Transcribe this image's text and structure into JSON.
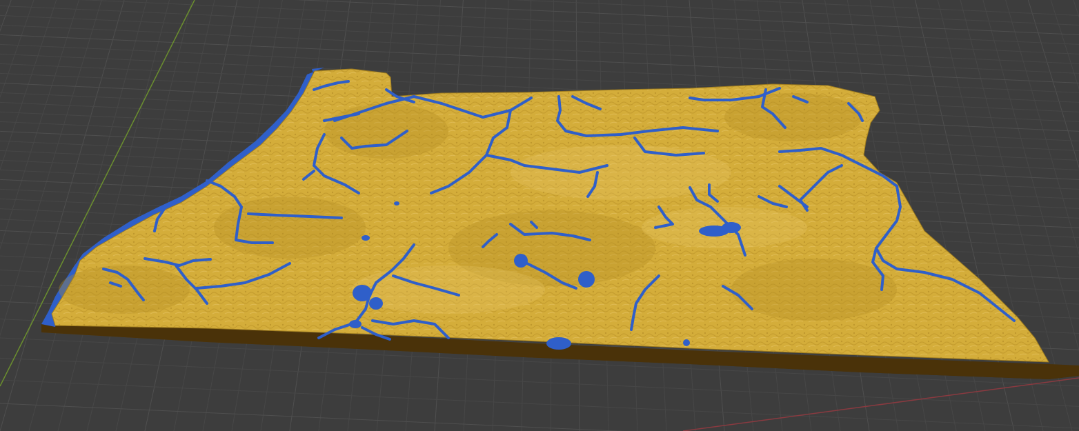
{
  "viewport": {
    "background_color": "#3d3d3d",
    "grid_minor_color": "#474747",
    "grid_major_color": "#4f4f4f",
    "x_axis_color": "#8a3a40",
    "y_axis_color": "#6b8f2e"
  },
  "model": {
    "terrain_top_color": "#d6b13c",
    "terrain_shade_color": "#b8922a",
    "terrain_side_color": "#5b3d0c",
    "water_color": "#2f5fc9",
    "water_edge_color": "#2a4fa8"
  }
}
